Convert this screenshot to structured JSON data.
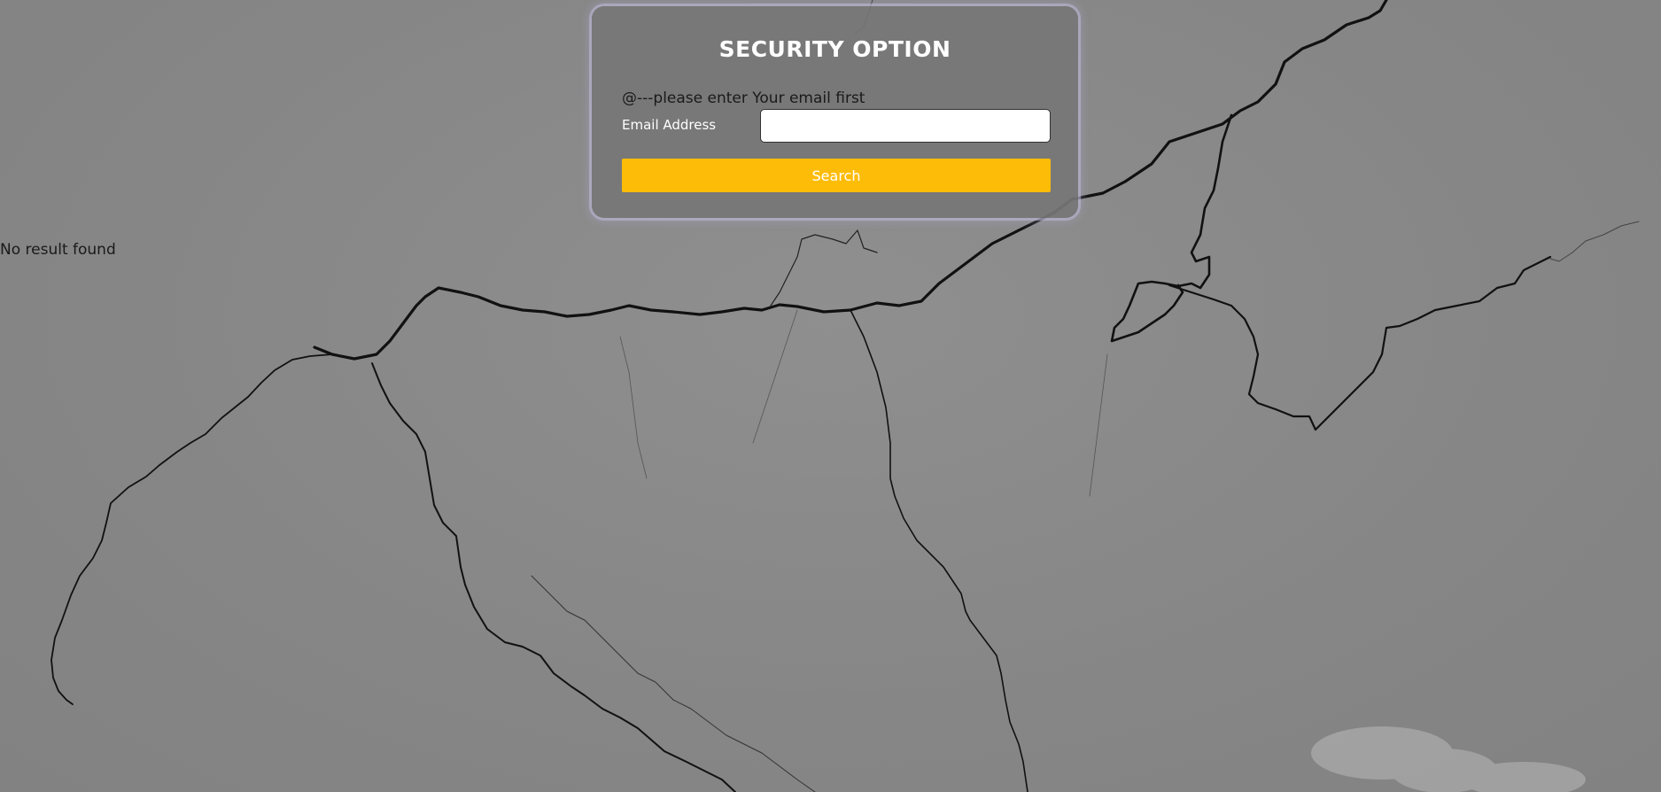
{
  "form": {
    "title": "SECURITY OPTION",
    "prompt": "@---please enter Your email first",
    "email_label": "Email Address",
    "email_value": "",
    "search_label": "Search"
  },
  "results": {
    "message": "No result found"
  },
  "colors": {
    "accent": "#fdbc08",
    "card": "#767676",
    "background": "#888888"
  }
}
